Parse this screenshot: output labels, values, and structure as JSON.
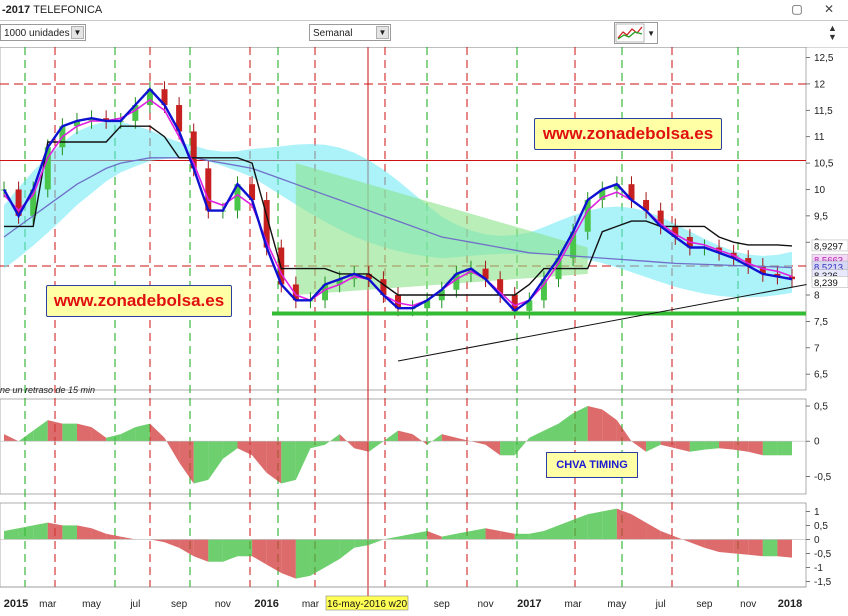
{
  "window": {
    "title_prefix": "-2017",
    "title": "TELEFONICA",
    "close": "✕",
    "minimize": "▢"
  },
  "toolbar": {
    "units_value": "1000 unidades",
    "period_value": "Semanal",
    "dropdown_arrow": "▼"
  },
  "watermarks": {
    "top": "www.zonadebolsa.es",
    "left": "www.zonadebolsa.es"
  },
  "notes": {
    "delay": "ne un retraso de 15 min",
    "indicator": "CHVA TIMING",
    "cursor_date": "16-may-2016 w20"
  },
  "colors": {
    "price_blue": "#1010d0",
    "price_magenta": "#e020e0",
    "black_line": "#111111",
    "trend_line": "#7070c8",
    "cyan_cloud": "#66e8f4",
    "green_cloud": "#8be38b",
    "support": "#33bb33",
    "red_dash": "#cc1111",
    "green_dash": "#11aa11",
    "osc_green": "#3cbf3c",
    "osc_red": "#d23a3a"
  },
  "chart_data": [
    {
      "type": "line",
      "name_hint": "price",
      "ylim": [
        6.2,
        12.7
      ],
      "yticks": [
        "12,5",
        "12",
        "11,5",
        "11",
        "10,5",
        "10",
        "9,5",
        "9",
        "8",
        "7,5",
        "7",
        "6,5"
      ],
      "ytick_values": [
        12.5,
        12,
        11.5,
        11,
        10.5,
        10,
        9.5,
        9,
        8,
        7.5,
        7,
        6.5
      ],
      "price_labels": [
        {
          "text": "8,9297",
          "value": 8.93
        },
        {
          "text": "8,5663",
          "value": 8.66
        },
        {
          "text": "8,5213",
          "value": 8.53
        },
        {
          "text": "8,326",
          "value": 8.37
        },
        {
          "text": "8,239",
          "value": 8.24
        }
      ],
      "xlabels": [
        "2015",
        "mar",
        "may",
        "jul",
        "sep",
        "nov",
        "2016",
        "mar",
        "jul",
        "sep",
        "nov",
        "2017",
        "mar",
        "may",
        "jul",
        "sep",
        "nov",
        "2018"
      ],
      "x_index": [
        0,
        2,
        4,
        6,
        8,
        10,
        12,
        14,
        18,
        20,
        22,
        24,
        26,
        28,
        30,
        32,
        34,
        36
      ],
      "series": [
        {
          "values": [
            10.0,
            9.5,
            10.0,
            10.8,
            11.2,
            11.3,
            11.35,
            11.3,
            11.3,
            11.6,
            11.9,
            11.6,
            11.1,
            10.4,
            9.6,
            9.6,
            10.1,
            9.8,
            8.9,
            8.2,
            7.9,
            7.9,
            8.2,
            8.3,
            8.4,
            8.3,
            8.0,
            7.75,
            7.75,
            7.9,
            8.1,
            8.4,
            8.5,
            8.3,
            8.0,
            7.7,
            7.9,
            8.3,
            8.7,
            9.2,
            9.8,
            10.0,
            10.1,
            9.8,
            9.6,
            9.3,
            9.1,
            8.9,
            8.9,
            8.8,
            8.7,
            8.55,
            8.4,
            8.35,
            8.3
          ]
        },
        {
          "values": [
            9.9,
            9.6,
            9.9,
            10.6,
            11.0,
            11.2,
            11.3,
            11.3,
            11.35,
            11.5,
            11.7,
            11.5,
            11.0,
            10.5,
            9.8,
            9.7,
            9.9,
            9.7,
            9.0,
            8.4,
            8.0,
            7.9,
            8.1,
            8.2,
            8.35,
            8.3,
            8.0,
            7.85,
            7.8,
            7.9,
            8.1,
            8.3,
            8.45,
            8.3,
            8.05,
            7.8,
            7.9,
            8.2,
            8.6,
            9.1,
            9.6,
            9.85,
            9.95,
            9.8,
            9.6,
            9.35,
            9.15,
            9.0,
            8.95,
            8.85,
            8.75,
            8.6,
            8.5,
            8.45,
            8.35
          ]
        },
        {
          "values": [
            9.3,
            9.3,
            9.3,
            10.9,
            10.9,
            10.9,
            10.9,
            10.9,
            11.2,
            11.2,
            11.2,
            11.0,
            10.6,
            10.6,
            10.6,
            10.6,
            10.6,
            10.5,
            9.5,
            8.5,
            8.5,
            8.5,
            8.5,
            8.4,
            8.4,
            8.4,
            8.2,
            8.0,
            8.0,
            8.0,
            8.0,
            8.0,
            8.0,
            8.0,
            8.0,
            8.0,
            8.2,
            8.5,
            8.5,
            8.5,
            8.5,
            9.2,
            9.3,
            9.4,
            9.4,
            9.3,
            9.3,
            9.3,
            9.3,
            9.1,
            9.0,
            8.95,
            8.95,
            8.95,
            8.93
          ]
        },
        {
          "values": [
            9.1,
            9.3,
            9.5,
            9.7,
            9.9,
            10.1,
            10.25,
            10.4,
            10.5,
            10.55,
            10.6,
            10.6,
            10.6,
            10.6,
            10.55,
            10.5,
            10.45,
            10.4,
            10.3,
            10.2,
            10.1,
            10.0,
            9.9,
            9.8,
            9.7,
            9.6,
            9.5,
            9.4,
            9.3,
            9.2,
            9.1,
            9.05,
            9.0,
            8.95,
            8.9,
            8.85,
            8.8,
            8.78,
            8.76,
            8.74,
            8.72,
            8.7,
            8.68,
            8.66,
            8.64,
            8.62,
            8.6,
            8.59,
            8.58,
            8.57,
            8.56,
            8.55,
            8.54,
            8.53,
            8.52
          ]
        }
      ],
      "support_level": 7.65,
      "resistance_level": 10.55,
      "red_horizontals": [
        12.0,
        8.55
      ],
      "trend_line": {
        "from": [
          6.75,
          27
        ],
        "to": [
          8.2,
          55
        ]
      }
    },
    {
      "type": "area",
      "name_hint": "oscillator-1",
      "ylim": [
        -0.75,
        0.6
      ],
      "yticks": [
        "0,5",
        "0",
        "-0,5"
      ],
      "ytick_values": [
        0.5,
        0,
        -0.5
      ],
      "values": [
        0.1,
        0.0,
        0.15,
        0.3,
        0.25,
        0.25,
        0.2,
        0.05,
        0.1,
        0.2,
        0.25,
        0.05,
        -0.3,
        -0.6,
        -0.55,
        -0.25,
        -0.1,
        -0.2,
        -0.45,
        -0.6,
        -0.55,
        -0.1,
        -0.05,
        0.1,
        -0.1,
        -0.15,
        0.0,
        0.15,
        0.1,
        -0.05,
        0.1,
        0.05,
        0.0,
        -0.05,
        -0.2,
        -0.2,
        0.05,
        0.15,
        0.25,
        0.4,
        0.5,
        0.45,
        0.3,
        0.0,
        -0.15,
        -0.05,
        -0.1,
        -0.15,
        -0.12,
        -0.1,
        -0.12,
        -0.15,
        -0.2,
        -0.2,
        -0.2
      ]
    },
    {
      "type": "area",
      "name_hint": "oscillator-2",
      "ylim": [
        -1.7,
        1.3
      ],
      "yticks": [
        "1",
        "0,5",
        "0",
        "-0,5",
        "-1",
        "-1,5"
      ],
      "ytick_values": [
        1,
        0.5,
        0,
        -0.5,
        -1,
        -1.5
      ],
      "values": [
        0.3,
        0.4,
        0.5,
        0.6,
        0.5,
        0.5,
        0.4,
        0.2,
        0.1,
        0.0,
        0.0,
        -0.1,
        -0.3,
        -0.6,
        -0.8,
        -0.8,
        -0.6,
        -0.6,
        -0.9,
        -1.2,
        -1.4,
        -1.3,
        -1.0,
        -0.7,
        -0.3,
        -0.2,
        0.0,
        0.1,
        0.2,
        0.3,
        0.1,
        0.2,
        0.3,
        0.4,
        0.3,
        0.2,
        0.2,
        0.3,
        0.5,
        0.7,
        0.9,
        1.0,
        1.1,
        0.9,
        0.6,
        0.3,
        0.1,
        -0.1,
        -0.3,
        -0.45,
        -0.5,
        -0.55,
        -0.6,
        -0.6,
        -0.65
      ]
    }
  ]
}
